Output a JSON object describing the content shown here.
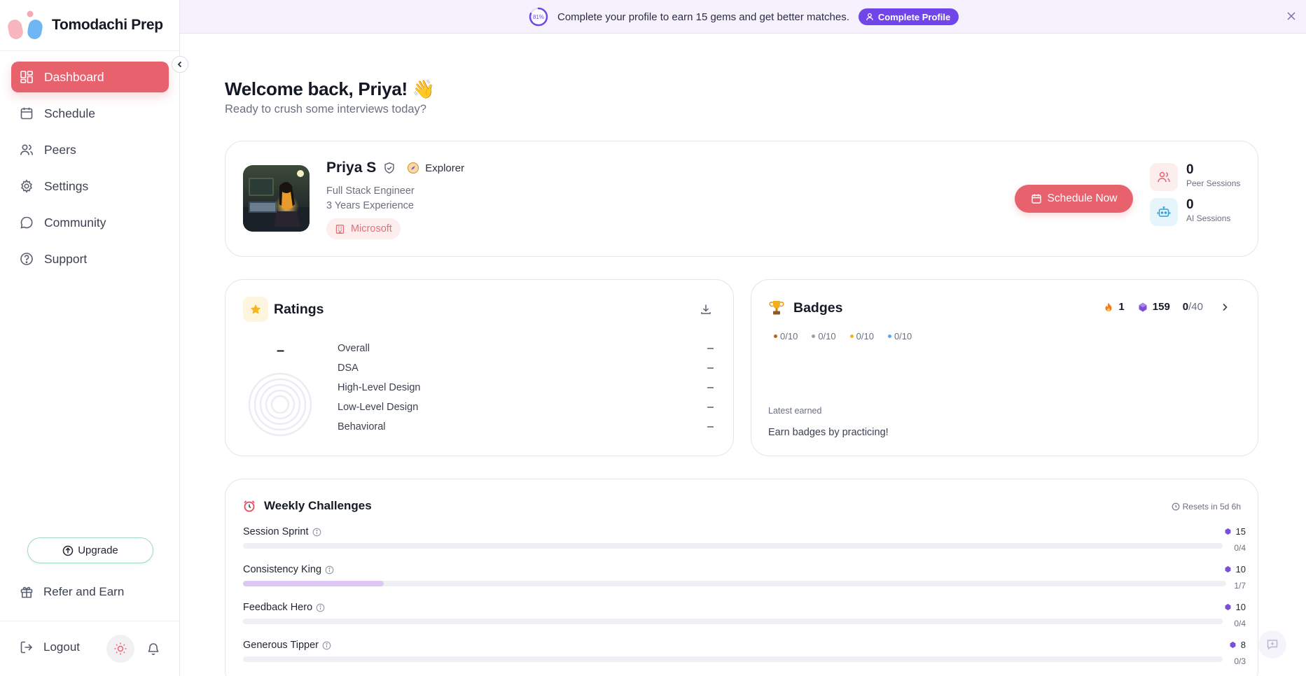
{
  "brand": {
    "name": "Tomodachi Prep"
  },
  "sidebar": {
    "items": [
      {
        "label": "Dashboard",
        "icon": "dashboard-icon",
        "active": true
      },
      {
        "label": "Schedule",
        "icon": "calendar-icon"
      },
      {
        "label": "Peers",
        "icon": "users-icon"
      },
      {
        "label": "Settings",
        "icon": "gear-icon"
      },
      {
        "label": "Community",
        "icon": "chat-icon"
      },
      {
        "label": "Support",
        "icon": "help-icon"
      }
    ],
    "upgrade_label": "Upgrade",
    "refer_label": "Refer and Earn",
    "logout_label": "Logout"
  },
  "banner": {
    "progress_text": "81%",
    "progress_value": 0.81,
    "message": "Complete your profile to earn 15 gems and get better matches.",
    "button_label": "Complete Profile"
  },
  "greeting": {
    "title": "Welcome back, Priya!",
    "emoji": "👋",
    "subtitle": "Ready to crush some interviews today?"
  },
  "profile": {
    "name": "Priya S",
    "level": "Explorer",
    "title": "Full Stack Engineer",
    "experience": "3 Years Experience",
    "company": "Microsoft",
    "schedule_label": "Schedule Now",
    "stats": [
      {
        "value": "0",
        "label": "Peer Sessions"
      },
      {
        "value": "0",
        "label": "AI Sessions"
      }
    ]
  },
  "ratings": {
    "title": "Ratings",
    "overall_value": "–",
    "rows": [
      {
        "label": "Overall",
        "value": "–"
      },
      {
        "label": "DSA",
        "value": "–"
      },
      {
        "label": "High-Level Design",
        "value": "–"
      },
      {
        "label": "Low-Level Design",
        "value": "–"
      },
      {
        "label": "Behavioral",
        "value": "–"
      }
    ]
  },
  "badges": {
    "title": "Badges",
    "streak": "1",
    "gems": "159",
    "earned": "0",
    "total": "/40",
    "tiers": [
      {
        "label": "0/10",
        "color": "#b8621b"
      },
      {
        "label": "0/10",
        "color": "#9aa0a8"
      },
      {
        "label": "0/10",
        "color": "#f2b01e"
      },
      {
        "label": "0/10",
        "color": "#5aa6f0"
      }
    ],
    "latest_label": "Latest earned",
    "latest_text": "Earn badges by practicing!"
  },
  "weekly": {
    "title": "Weekly Challenges",
    "resets": "Resets in 5d 6h",
    "challenges": [
      {
        "name": "Session Sprint",
        "gems": "15",
        "progress": "0/4",
        "fraction": 0
      },
      {
        "name": "Consistency King",
        "gems": "10",
        "progress": "1/7",
        "fraction": 0.143
      },
      {
        "name": "Feedback Hero",
        "gems": "10",
        "progress": "0/4",
        "fraction": 0
      },
      {
        "name": "Generous Tipper",
        "gems": "8",
        "progress": "0/3",
        "fraction": 0
      }
    ]
  },
  "colors": {
    "accent": "#e8626e",
    "purple": "#7046e8",
    "progress_fill": "#dcc8f2"
  }
}
